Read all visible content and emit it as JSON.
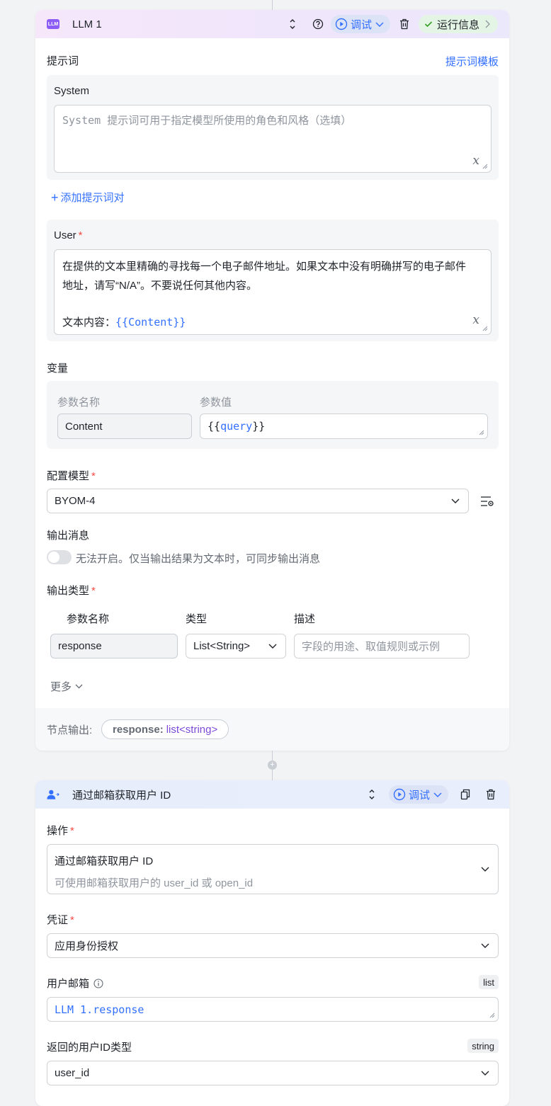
{
  "llm_node": {
    "title": "LLM 1",
    "icon_text": "LLM",
    "debug_label": "调试",
    "run_info_label": "运行信息",
    "prompt_section": "提示词",
    "prompt_template_link": "提示词模板",
    "system_label": "System",
    "system_placeholder": "System 提示词可用于指定模型所使用的角色和风格（选填）",
    "add_prompt_pair": "添加提示词对",
    "user_label": "User",
    "user_text_line1": "在提供的文本里精确的寻找每一个电子邮件地址。如果文本中没有明确拼写的电子邮件",
    "user_text_line2": "地址，请写“N/A”。不要说任何其他内容。",
    "user_text_line3_prefix": "文本内容：",
    "user_text_var": "{{Content}}",
    "variables_section": "变量",
    "param_name_header": "参数名称",
    "param_value_header": "参数值",
    "var_name": "Content",
    "var_value_open": "{{",
    "var_value_name": "query",
    "var_value_close": "}}",
    "model_section": "配置模型",
    "model_value": "BYOM-4",
    "output_msg_section": "输出消息",
    "output_msg_hint": "无法开启。仅当输出结果为文本时，可同步输出消息",
    "output_type_section": "输出类型",
    "col_param_name": "参数名称",
    "col_type": "类型",
    "col_desc": "描述",
    "out_name": "response",
    "out_type": "List<String>",
    "out_desc_placeholder": "字段的用途、取值规则或示例",
    "more_label": "更多",
    "node_output_label": "节点输出:",
    "node_output_key": "response:",
    "node_output_type": "list<string>"
  },
  "user_node": {
    "title": "通过邮箱获取用户 ID",
    "debug_label": "调试",
    "operation_section": "操作",
    "operation_value": "通过邮箱获取用户 ID",
    "operation_desc": "可使用邮箱获取用户的 user_id 或 open_id",
    "credential_section": "凭证",
    "credential_value": "应用身份授权",
    "email_section": "用户邮箱",
    "email_tag": "list",
    "email_value_prefix": "LLM 1.",
    "email_value_field": "response",
    "id_type_section": "返回的用户ID类型",
    "id_type_tag": "string",
    "id_type_value": "user_id"
  },
  "colors": {
    "accent": "#3370ff",
    "required": "#f54a45",
    "success": "#34c724",
    "llm_icon": "#8b5cf6"
  }
}
